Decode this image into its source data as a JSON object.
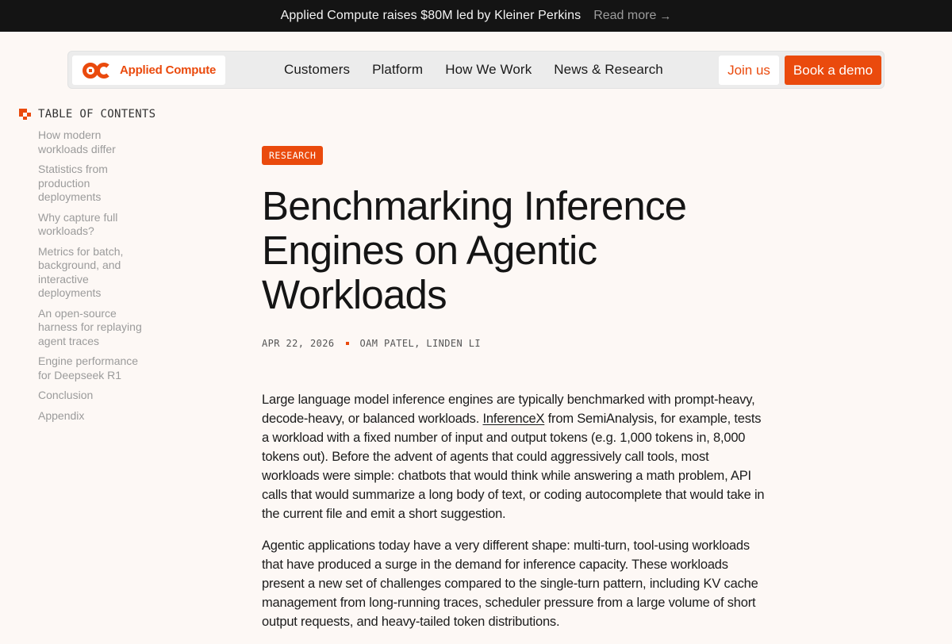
{
  "announcement": {
    "message": "Applied Compute raises $80M led by Kleiner Perkins",
    "link_label": "Read more",
    "link_arrow": "→"
  },
  "nav": {
    "logo_text": "Applied Compute",
    "links": [
      "Customers",
      "Platform",
      "How We Work",
      "News & Research"
    ],
    "join_label": "Join us",
    "demo_label": "Book a demo"
  },
  "toc": {
    "title": "TABLE OF CONTENTS",
    "items": [
      "How modern workloads differ",
      "Statistics from production deployments",
      "Why capture full workloads?",
      "Metrics for batch, background, and interactive deployments",
      "An open-source harness for replaying agent traces",
      "Engine performance for Deepseek R1",
      "Conclusion",
      "Appendix"
    ]
  },
  "article": {
    "badge": "RESEARCH",
    "title": "Benchmarking Inference Engines on Agentic Workloads",
    "date": "APR 22, 2026",
    "authors": "OAM PATEL, LINDEN LI",
    "p1_before_link": "Large language model inference engines are typically benchmarked with prompt-heavy, decode-heavy, or balanced workloads. ",
    "p1_link": "InferenceX",
    "p1_after_link": " from SemiAnalysis, for example, tests a workload with a fixed number of input and output tokens (e.g. 1,000 tokens in, 8,000 tokens out). Before the advent of agents that could aggressively call tools, most workloads were simple: chatbots that would think while answering a math problem, API calls that would summarize a long body of text, or coding autocomplete that would take in the current file and emit a short suggestion.",
    "p2": "Agentic applications today have a very different shape: multi-turn, tool-using workloads that have produced a surge in the demand for inference capacity. These workloads present a new set of challenges compared to the single-turn pattern, including KV cache management from long-running traces, scheduler pressure from a large volume of short output requests, and heavy-tailed token distributions."
  },
  "colors": {
    "accent": "#ea4a0d",
    "announcement_bg": "#141414",
    "page_bg": "#fdf8f5"
  },
  "icons": {
    "logo": "applied-compute-logo-icon",
    "toc": "toc-pixel-icon",
    "arrow": "arrow-right-icon"
  }
}
